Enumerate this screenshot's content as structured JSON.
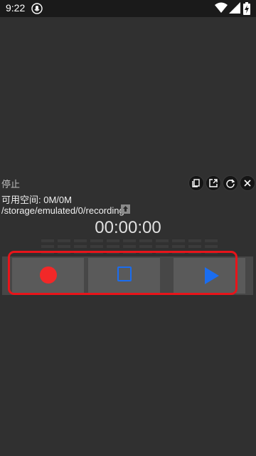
{
  "status_bar": {
    "time": "9:22",
    "app_icon": "notification-app-icon",
    "wifi_icon": "wifi-icon",
    "signal_icon": "cell-signal-icon",
    "battery_icon": "battery-charging-icon"
  },
  "recorder": {
    "state": "停止",
    "free_space": "可用空间: 0M/0M",
    "path": "/storage/emulated/0/recording",
    "timer": "00:00:00"
  },
  "toolbar_icons": [
    "copy-icon",
    "open-external-icon",
    "refresh-icon",
    "close-icon"
  ],
  "controls": {
    "record_color": "#f22828",
    "stop_color": "#1a6df0",
    "play_color": "#1a6df0",
    "highlight_color": "#e8141a"
  }
}
